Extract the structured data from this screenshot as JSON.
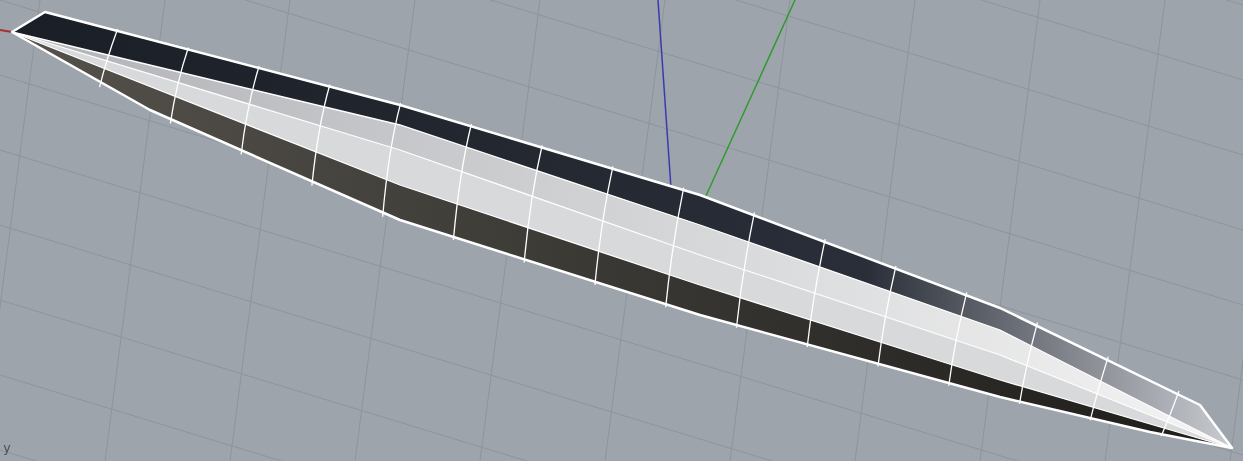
{
  "viewport": {
    "axis_label": "y"
  }
}
